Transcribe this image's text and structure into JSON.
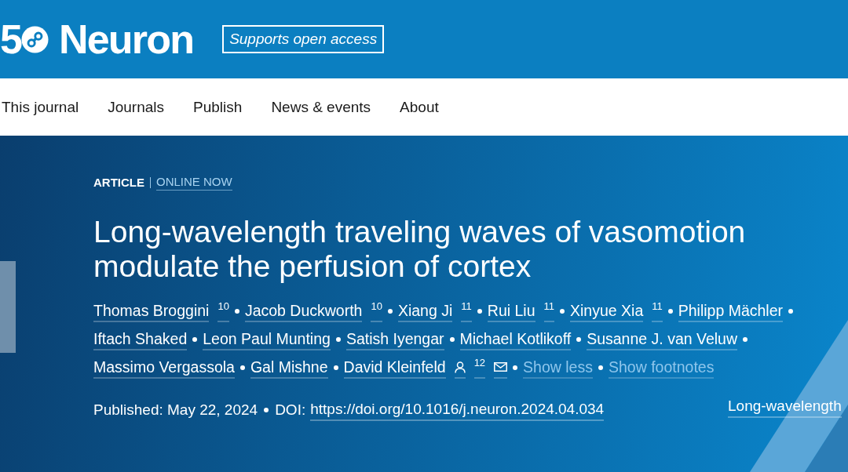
{
  "header": {
    "logo": {
      "mark": "5",
      "title": "Neuron"
    },
    "badge": "Supports open access"
  },
  "nav": {
    "items": [
      {
        "label": "This journal"
      },
      {
        "label": "Journals"
      },
      {
        "label": "Publish"
      },
      {
        "label": "News & events"
      },
      {
        "label": "About"
      }
    ]
  },
  "article": {
    "type": "ARTICLE",
    "status": "ONLINE NOW",
    "title": "Long-wavelength traveling waves of vasomotion modulate the perfusion of cortex",
    "authors": [
      {
        "name": "Thomas Broggini",
        "affiliation": "10",
        "corresponding": false
      },
      {
        "name": "Jacob Duckworth",
        "affiliation": "10",
        "corresponding": false
      },
      {
        "name": "Xiang Ji",
        "affiliation": "11",
        "corresponding": false
      },
      {
        "name": "Rui Liu",
        "affiliation": "11",
        "corresponding": false
      },
      {
        "name": "Xinyue Xia",
        "affiliation": "11",
        "corresponding": false
      },
      {
        "name": "Philipp Mächler",
        "corresponding": false
      },
      {
        "name": "Iftach Shaked",
        "corresponding": false
      },
      {
        "name": "Leon Paul Munting",
        "corresponding": false
      },
      {
        "name": "Satish Iyengar",
        "corresponding": false
      },
      {
        "name": "Michael Kotlikoff",
        "corresponding": false
      },
      {
        "name": "Susanne J. van Veluw",
        "corresponding": false
      },
      {
        "name": "Massimo Vergassola",
        "corresponding": false
      },
      {
        "name": "Gal Mishne",
        "corresponding": false
      },
      {
        "name": "David Kleinfeld",
        "affiliation": "12",
        "corresponding": true
      }
    ],
    "links": [
      "Show less",
      "Show footnotes"
    ],
    "published": "Published: May 22, 2024",
    "doi_label": "DOI:",
    "doi": "https://doi.org/10.1016/j.neuron.2024.04.034"
  },
  "cover": {
    "caption": "Long-wavelength"
  }
}
